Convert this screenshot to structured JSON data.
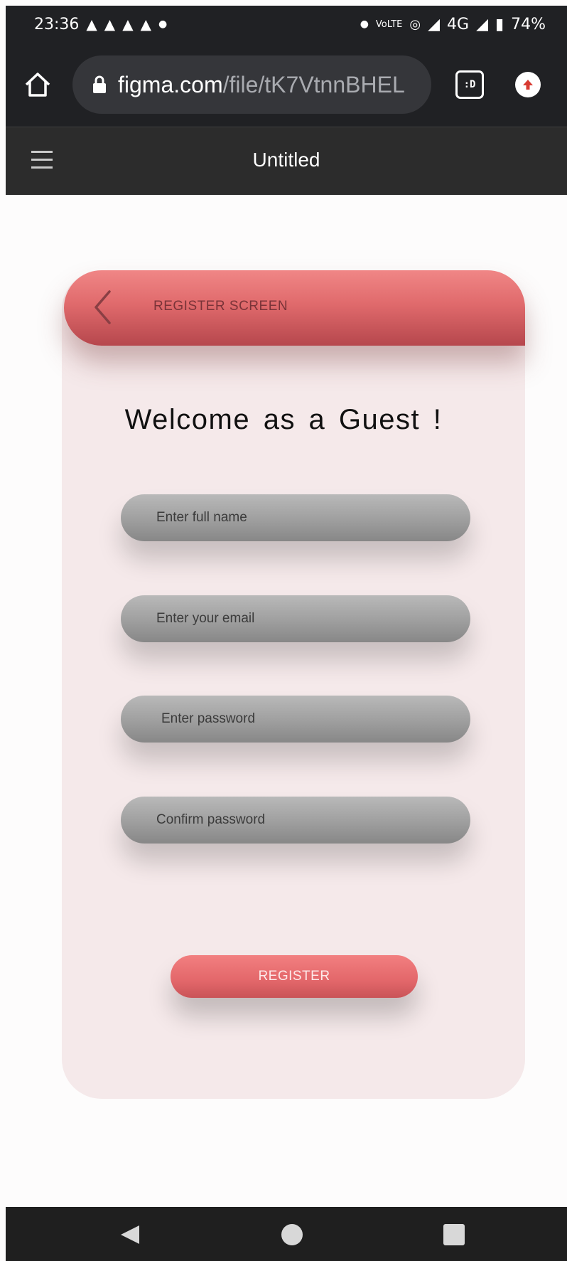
{
  "status_bar": {
    "time": "23:36",
    "notification_icons": [
      "snapchat-icon",
      "snapchat-icon",
      "snapchat-icon",
      "snapchat-icon"
    ],
    "network": "4G",
    "battery": "74%"
  },
  "browser": {
    "url_domain": "figma.com",
    "url_path": "/file/tK7VtnnBHEL",
    "tab_label": ":D"
  },
  "figma": {
    "title": "Untitled"
  },
  "screen": {
    "header_title": "REGISTER SCREEN",
    "welcome_text": "Welcome as a Guest !",
    "fields": [
      {
        "placeholder": "Enter full name"
      },
      {
        "placeholder": "Enter your email"
      },
      {
        "placeholder": "Enter password"
      },
      {
        "placeholder": "Confirm password"
      }
    ],
    "register_label": "REGISTER"
  },
  "colors": {
    "accent": "#e56c6e",
    "card": "#f5e9ea",
    "field": "#a3a3a3"
  }
}
